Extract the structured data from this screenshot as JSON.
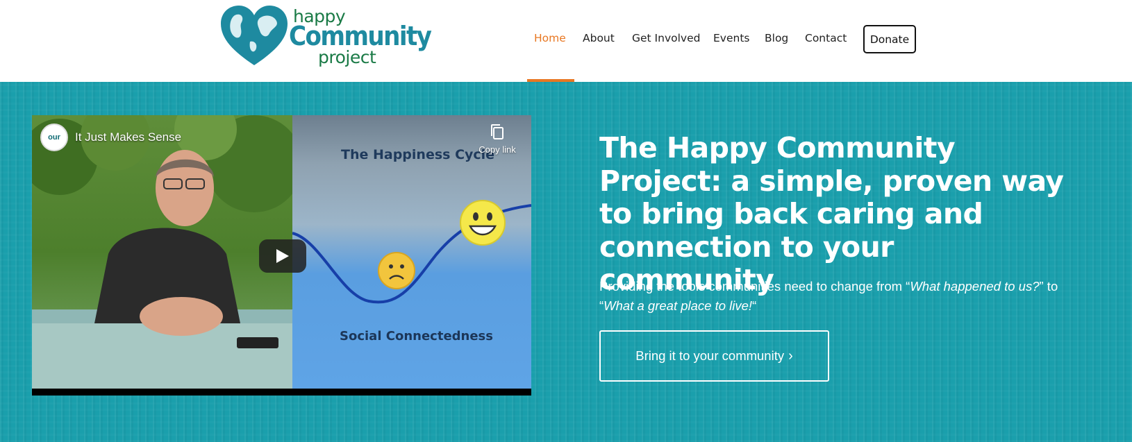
{
  "header": {
    "logo": {
      "line1": "happy",
      "line2": "Community",
      "line3": "project"
    },
    "nav": [
      {
        "label": "Home",
        "active": true
      },
      {
        "label": "About",
        "active": false
      },
      {
        "label": "Get Involved",
        "active": false
      },
      {
        "label": "Events",
        "active": false
      },
      {
        "label": "Blog",
        "active": false
      },
      {
        "label": "Contact",
        "active": false
      }
    ],
    "donate_label": "Donate",
    "colors": {
      "accent": "#e87722",
      "logo_teal": "#1e8aa0",
      "logo_green": "#1a7a46"
    }
  },
  "hero": {
    "background": "#1a9fac",
    "video": {
      "title": "It Just Makes Sense",
      "channel_badge": "our",
      "copy_link_label": "Copy link",
      "slide_title": "The Happiness Cycle",
      "slide_caption": "Social Connectedness",
      "icons": [
        "copy-icon",
        "play-icon",
        "sad-face-icon",
        "smiley-face-icon"
      ]
    },
    "headline": "The Happy Community Project: a simple, proven way to bring back caring and connection to your community",
    "subline": {
      "prefix": "Providing the tools communities need to change from “",
      "italic1": "What happened to us?",
      "middle": "” to “",
      "italic2": "What a great place to live!",
      "suffix": "“"
    },
    "cta_label": "Bring it to your community"
  }
}
